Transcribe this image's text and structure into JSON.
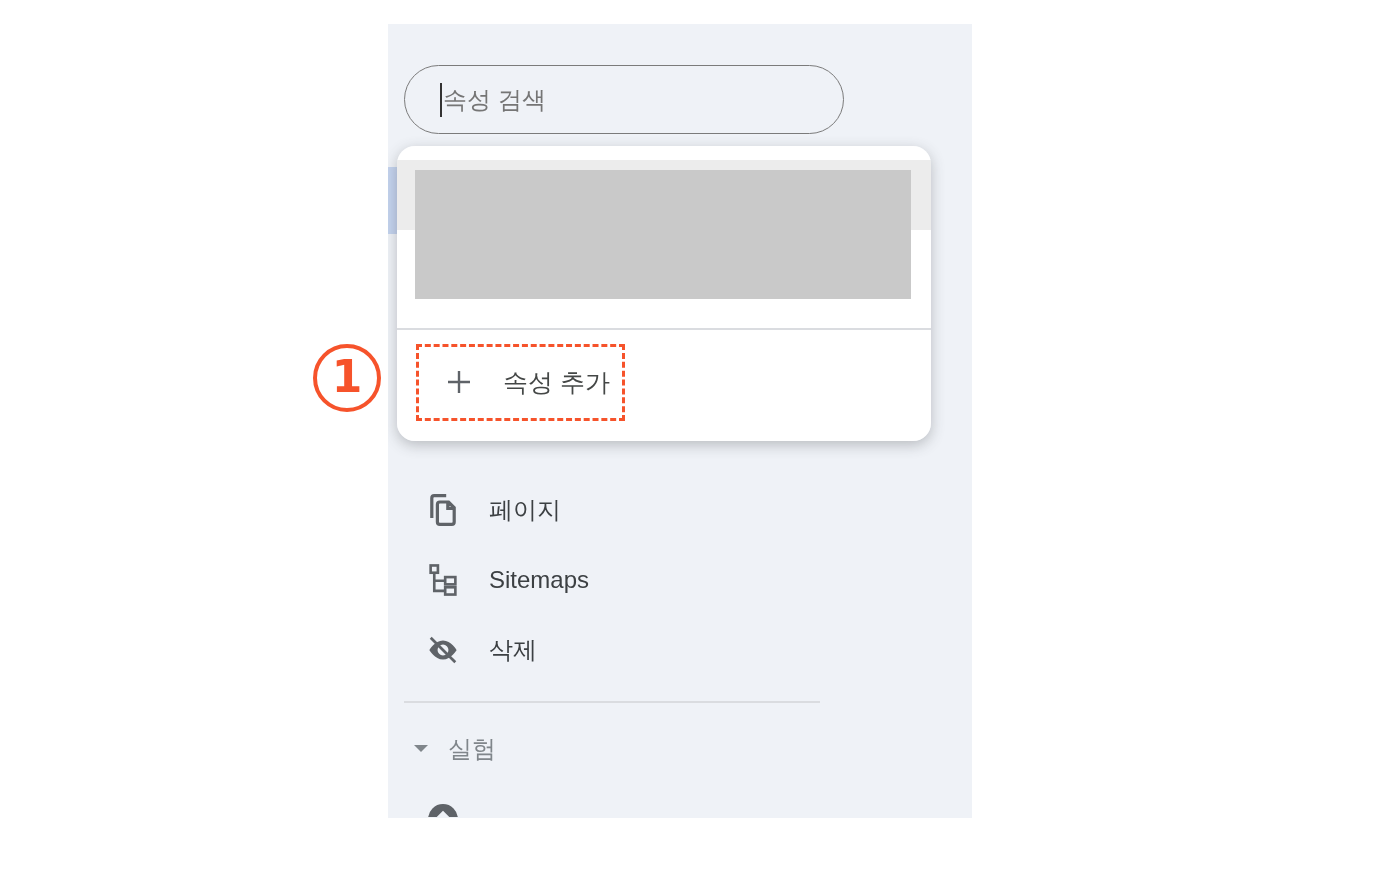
{
  "search": {
    "placeholder": "속성 검색",
    "focused": true
  },
  "property_menu": {
    "add_item": {
      "label": "속성 추가",
      "highlighted": true
    }
  },
  "nav": {
    "sections": [
      {
        "items": [
          {
            "label": "페이지"
          },
          {
            "label": "Sitemaps"
          },
          {
            "label": "삭제"
          }
        ]
      },
      {
        "title": "실험",
        "expanded": true
      }
    ]
  },
  "annotation": {
    "number": "1"
  }
}
